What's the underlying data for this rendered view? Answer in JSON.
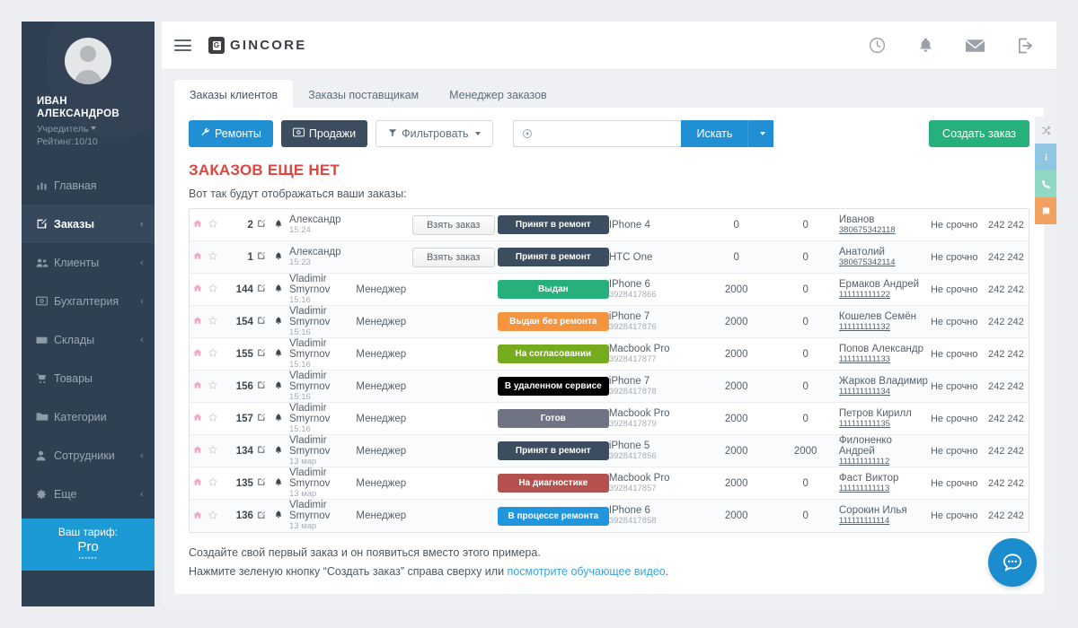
{
  "sidebar": {
    "user": {
      "name": "ИВАН\nАЛЕКСАНДРОВ",
      "name_line1": "ИВАН",
      "name_line2": "АЛЕКСАНДРОВ",
      "role": "Учредитель",
      "rating": "Рейтинг:10/10",
      "avatar_icon": "user-avatar-icon"
    },
    "items": [
      {
        "label": "Главная",
        "icon": "chart-bar-icon",
        "glyph": "▥",
        "arrow": "",
        "active": false
      },
      {
        "label": "Заказы",
        "icon": "edit-square-icon",
        "glyph": "✎",
        "arrow": "‹",
        "active": true
      },
      {
        "label": "Клиенты",
        "icon": "users-icon",
        "glyph": "👥",
        "arrow": "‹",
        "active": false
      },
      {
        "label": "Бухгалтерия",
        "icon": "money-icon",
        "glyph": "▣",
        "arrow": "‹",
        "active": false
      },
      {
        "label": "Склады",
        "icon": "box-icon",
        "glyph": "▢",
        "arrow": "‹",
        "active": false
      },
      {
        "label": "Товары",
        "icon": "cart-icon",
        "glyph": "🛒",
        "arrow": "",
        "active": false
      },
      {
        "label": "Категории",
        "icon": "folder-icon",
        "glyph": "📁",
        "arrow": "",
        "active": false
      },
      {
        "label": "Сотрудники",
        "icon": "person-icon",
        "glyph": "👤",
        "arrow": "‹",
        "active": false
      },
      {
        "label": "Еще",
        "icon": "gear-icon",
        "glyph": "⚙",
        "arrow": "‹",
        "active": false
      }
    ],
    "tariff": {
      "label": "Ваш тариф:",
      "plan": "Pro",
      "sub": "▪▪▪▪▪▪",
      "color": "#1b9ad6"
    }
  },
  "header": {
    "menu_icon": "hamburger-menu-icon",
    "logo_text": "GINCORE",
    "logo_mark": "gincore-logo-icon",
    "icons": [
      {
        "name": "clock-icon"
      },
      {
        "name": "bell-icon"
      },
      {
        "name": "envelope-icon"
      },
      {
        "name": "logout-icon"
      }
    ]
  },
  "tabs": [
    {
      "label": "Заказы клиентов",
      "active": true
    },
    {
      "label": "Заказы поставщикам",
      "active": false
    },
    {
      "label": "Менеджер заказов",
      "active": false
    }
  ],
  "toolbar": {
    "repairs_label": "Ремонты",
    "repairs_icon": "wrench-icon",
    "sales_label": "Продажи",
    "sales_icon": "money-icon",
    "filter_label": "Фильтровать",
    "filter_icon": "funnel-icon",
    "search_icon": "circle-target-icon",
    "search_value": "",
    "search_placeholder": "",
    "search_button": "Искать",
    "search_caret_icon": "chevron-down-icon",
    "create_order_label": "Создать заказ",
    "colors": {
      "blue": "#218fd4",
      "dark": "#3b4d5f",
      "green": "#26b07c"
    }
  },
  "content": {
    "heading": "ЗАКАЗОВ ЕЩЕ НЕТ",
    "subheading": "Вот так будут отображаться ваши заказы:",
    "footnote_line1": "Создайте свой первый заказ и он появиться вместо этого примера.",
    "footnote_line2_before": "Нажмите зеленую кнопку “Создать заказ” справа сверху или ",
    "footnote_link": "посмотрите обучающее видео",
    "footnote_after": "."
  },
  "table": {
    "icons": {
      "home": "home-icon",
      "star": "star-icon",
      "edit": "edit-icon",
      "bell": "bell-icon"
    },
    "rows": [
      {
        "num": "2",
        "time": "15:24",
        "who": "Александр",
        "role": "",
        "action": "Взять заказ",
        "status": "Принят в ремонт",
        "status_color": "#3b4d5f",
        "device": "IPhone 4",
        "imei": "",
        "sum1": "0",
        "sum2": "0",
        "client": "Иванов",
        "phone": "380675342118",
        "urgency": "Не срочно",
        "code": "242 242"
      },
      {
        "num": "1",
        "time": "15:23",
        "who": "Александр",
        "role": "",
        "action": "Взять заказ",
        "status": "Принят в ремонт",
        "status_color": "#3b4d5f",
        "device": "HTC One",
        "imei": "",
        "sum1": "0",
        "sum2": "0",
        "client": "Анатолий",
        "phone": "380675342114",
        "urgency": "Не срочно",
        "code": "242 242"
      },
      {
        "num": "144",
        "time": "15:16",
        "who": "Vladimir Smyrnov",
        "role": "Менеджер",
        "action": "",
        "status": "Выдан",
        "status_color": "#26b07c",
        "device": "IPhone 6",
        "imei": "3928417866",
        "sum1": "2000",
        "sum2": "0",
        "client": "Ермаков Андрей",
        "phone": "111111111122",
        "urgency": "Не срочно",
        "code": "242 242"
      },
      {
        "num": "154",
        "time": "15:16",
        "who": "Vladimir Smyrnov",
        "role": "Менеджер",
        "action": "",
        "status": "Выдан без ремонта",
        "status_color": "#f5943f",
        "device": "iPhone 7",
        "imei": "3928417876",
        "sum1": "2000",
        "sum2": "0",
        "client": "Кошелев Семён",
        "phone": "111111111132",
        "urgency": "Не срочно",
        "code": "242 242"
      },
      {
        "num": "155",
        "time": "15:16",
        "who": "Vladimir Smyrnov",
        "role": "Менеджер",
        "action": "",
        "status": "На согласовании",
        "status_color": "#76ab1e",
        "device": "Macbook Pro",
        "imei": "3928417877",
        "sum1": "2000",
        "sum2": "0",
        "client": "Попов Александр",
        "phone": "111111111133",
        "urgency": "Не срочно",
        "code": "242 242"
      },
      {
        "num": "156",
        "time": "15:16",
        "who": "Vladimir Smyrnov",
        "role": "Менеджер",
        "action": "",
        "status": "В удаленном сервисе",
        "status_color": "#000000",
        "device": "iPhone 7",
        "imei": "3928417878",
        "sum1": "2000",
        "sum2": "0",
        "client": "Жарков Владимир",
        "phone": "111111111134",
        "urgency": "Не срочно",
        "code": "242 242"
      },
      {
        "num": "157",
        "time": "15:16",
        "who": "Vladimir Smyrnov",
        "role": "Менеджер",
        "action": "",
        "status": "Готов",
        "status_color": "#6f7382",
        "device": "Macbook Pro",
        "imei": "3928417879",
        "sum1": "2000",
        "sum2": "0",
        "client": "Петров Кирилл",
        "phone": "111111111135",
        "urgency": "Не срочно",
        "code": "242 242"
      },
      {
        "num": "134",
        "time": "13 мар",
        "who": "Vladimir Smyrnov",
        "role": "Менеджер",
        "action": "",
        "status": "Принят в ремонт",
        "status_color": "#3b4d5f",
        "device": "iPhone 5",
        "imei": "3928417856",
        "sum1": "2000",
        "sum2": "2000",
        "client": "Филоненко Андрей",
        "phone": "111111111112",
        "urgency": "Не срочно",
        "code": "242 242"
      },
      {
        "num": "135",
        "time": "13 мар",
        "who": "Vladimir Smyrnov",
        "role": "Менеджер",
        "action": "",
        "status": "На диагностике",
        "status_color": "#b4504e",
        "device": "Macbook Pro",
        "imei": "3928417857",
        "sum1": "2000",
        "sum2": "0",
        "client": "Фаст Виктор",
        "phone": "111111111113",
        "urgency": "Не срочно",
        "code": "242 242"
      },
      {
        "num": "136",
        "time": "13 мар",
        "who": "Vladimir Smyrnov",
        "role": "Менеджер",
        "action": "",
        "status": "В процессе ремонта",
        "status_color": "#2196dd",
        "device": "IPhone 6",
        "imei": "3928417858",
        "sum1": "2000",
        "sum2": "0",
        "client": "Сорокин Илья",
        "phone": "111111111114",
        "urgency": "Не срочно",
        "code": "242 242"
      }
    ]
  },
  "rail": [
    {
      "name": "shuffle-icon",
      "glyph": "⤬",
      "color": "#eef0f4"
    },
    {
      "name": "info-icon",
      "glyph": "i",
      "color": "#8fc6e4"
    },
    {
      "name": "phone-icon",
      "glyph": "✆",
      "color": "#8fd9c2"
    },
    {
      "name": "book-icon",
      "glyph": "▰",
      "color": "#f0a060"
    }
  ],
  "chat_button": {
    "name": "chat-bubble-icon",
    "color": "#1b8ccd"
  }
}
